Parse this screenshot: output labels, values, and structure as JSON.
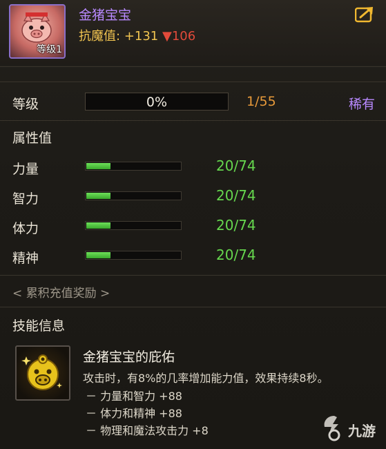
{
  "pet": {
    "name": "金猪宝宝",
    "level_badge": "等级1",
    "resist_label": "抗魔值:",
    "resist_value": "+131",
    "resist_drop": "▼106"
  },
  "level": {
    "label": "等级",
    "percent_text": "0%",
    "progress": 0,
    "count": "1/55",
    "rarity": "稀有"
  },
  "attributes": {
    "title": "属性值",
    "items": [
      {
        "label": "力量",
        "value": "20/74",
        "fill": 0.27
      },
      {
        "label": "智力",
        "value": "20/74",
        "fill": 0.27
      },
      {
        "label": "体力",
        "value": "20/74",
        "fill": 0.27
      },
      {
        "label": "精神",
        "value": "20/74",
        "fill": 0.27
      }
    ]
  },
  "reward_link": "< 累积充值奖励 >",
  "skill": {
    "title": "技能信息",
    "name": "金猪宝宝的庇佑",
    "description": "攻击时，有8%的几率增加能力值，效果持续8秒。",
    "effects": [
      "－ 力量和智力 +88",
      "－ 体力和精神 +88",
      "－ 物理和魔法攻击力 +8"
    ]
  },
  "watermark": {
    "text": "九游"
  },
  "colors": {
    "rare_purple": "#b889ff",
    "stat_green": "#66d84e",
    "accent_orange": "#e89a3a",
    "drop_red": "#e24a3a"
  }
}
